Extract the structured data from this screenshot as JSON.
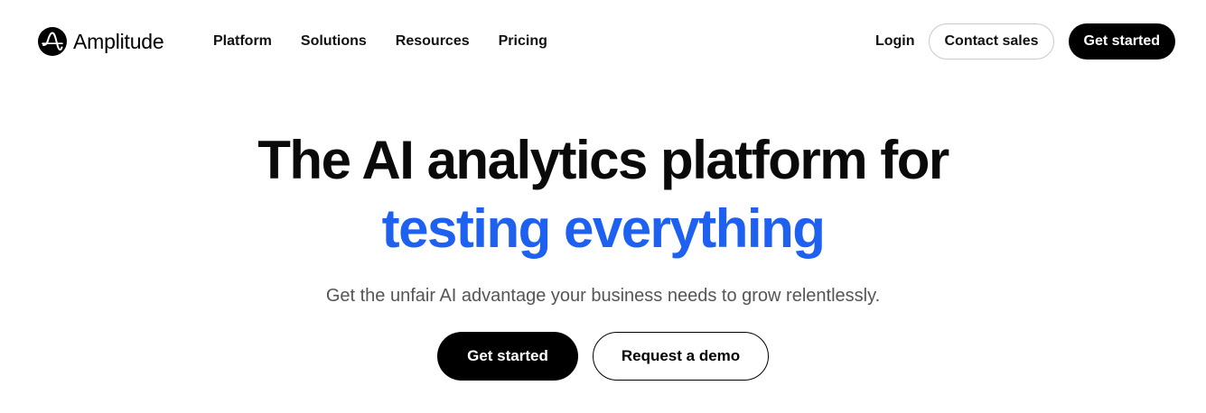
{
  "brand": {
    "name": "Amplitude",
    "logo_icon": "amplitude-logo-icon"
  },
  "nav": {
    "items": [
      {
        "label": "Platform"
      },
      {
        "label": "Solutions"
      },
      {
        "label": "Resources"
      },
      {
        "label": "Pricing"
      }
    ]
  },
  "header_actions": {
    "login_label": "Login",
    "contact_label": "Contact sales",
    "get_started_label": "Get started"
  },
  "hero": {
    "headline_line1": "The AI analytics platform for",
    "headline_line2": "testing everything",
    "subtitle": "Get the unfair AI advantage your business needs to grow relentlessly.",
    "primary_cta": "Get started",
    "secondary_cta": "Request a demo"
  },
  "colors": {
    "accent": "#1e61f0",
    "primary": "#000000",
    "background": "#ffffff",
    "subtitle": "#555555"
  }
}
